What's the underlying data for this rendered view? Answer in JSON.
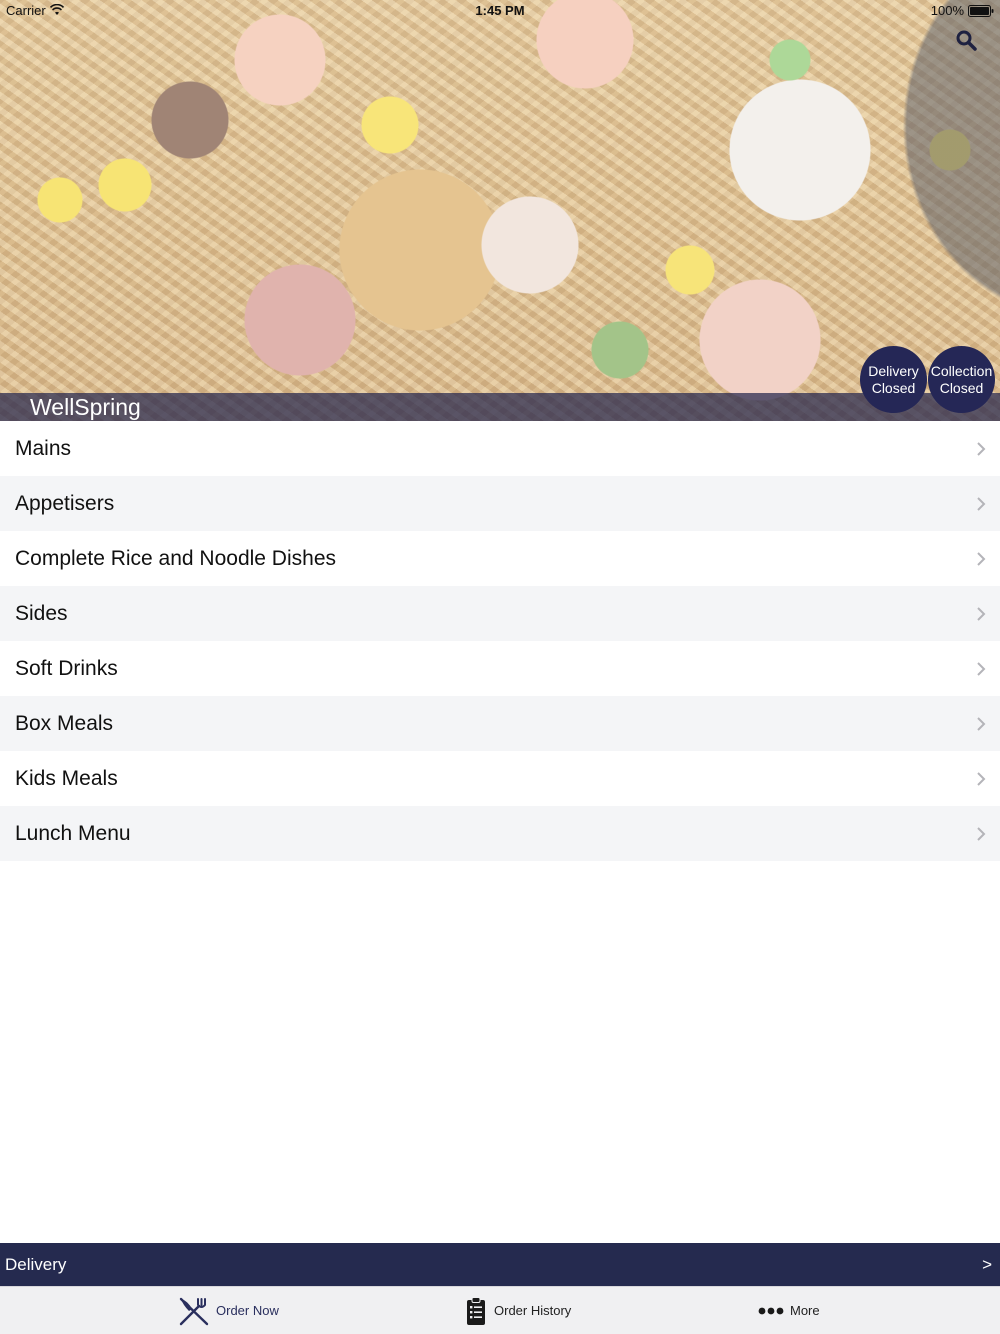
{
  "status_bar": {
    "carrier": "Carrier",
    "time": "1:45 PM",
    "battery": "100%"
  },
  "hero": {
    "restaurant_name": "WellSpring",
    "delivery_status": {
      "line1": "Delivery",
      "line2": "Closed"
    },
    "collection_status": {
      "line1": "Collection",
      "line2": "Closed"
    }
  },
  "menu": {
    "categories": [
      {
        "label": "Mains"
      },
      {
        "label": "Appetisers"
      },
      {
        "label": "Complete Rice and Noodle Dishes"
      },
      {
        "label": "Sides"
      },
      {
        "label": "Soft Drinks"
      },
      {
        "label": "Box Meals"
      },
      {
        "label": "Kids Meals"
      },
      {
        "label": "Lunch Menu"
      }
    ]
  },
  "delivery_bar": {
    "label": "Delivery",
    "arrow": ">"
  },
  "tab_bar": {
    "tabs": [
      {
        "label": "Order Now",
        "icon": "fork-knife-icon"
      },
      {
        "label": "Order History",
        "icon": "clipboard-icon"
      },
      {
        "label": "More",
        "icon": "more-dots-icon"
      }
    ]
  },
  "colors": {
    "brand_navy": "#252a4f",
    "circle_navy": "#252756",
    "row_alt": "#f4f5f7"
  }
}
